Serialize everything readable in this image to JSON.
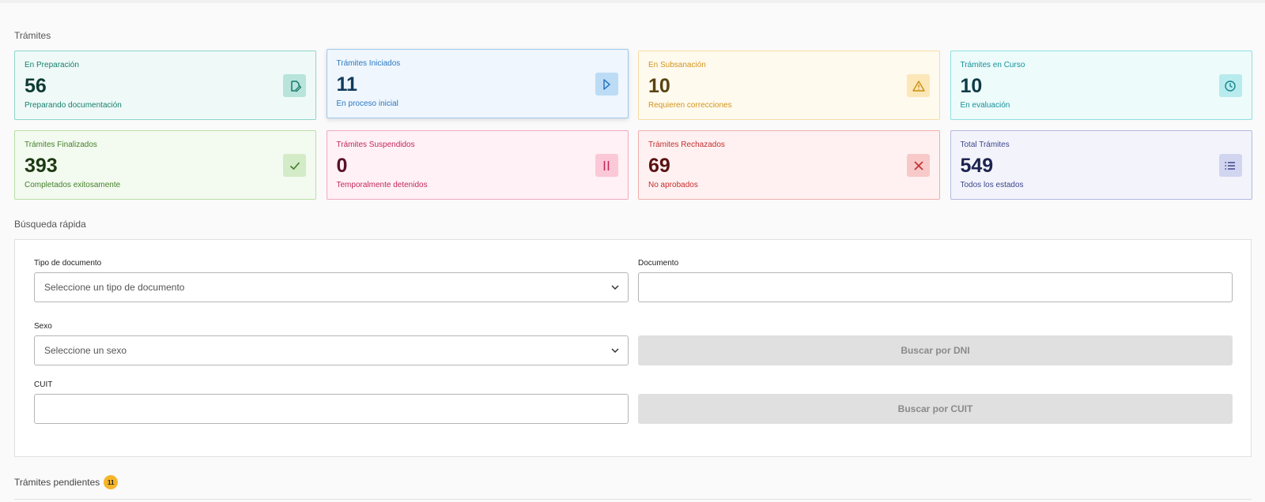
{
  "sections": {
    "tramites": "Trámites",
    "busqueda": "Búsqueda rápida",
    "pendientes": "Trámites pendientes",
    "pendientes_count": "11"
  },
  "cards": [
    {
      "title": "En Preparación",
      "value": "56",
      "sub": "Preparando documentación",
      "icon": "edit-document-icon",
      "colors": {
        "bg": "#effaf8",
        "border": "#8fd5c8",
        "title": "#17806d",
        "value": "#0e3b33",
        "iconbg": "#b9e4dc",
        "icon": "#157a68"
      }
    },
    {
      "title": "Trámites Iniciados",
      "value": "11",
      "sub": "En proceso inicial",
      "icon": "play-icon",
      "colors": {
        "bg": "#eff6fd",
        "border": "#9ec8ec",
        "title": "#2a78c0",
        "value": "#123a5c",
        "iconbg": "#bcdcf6",
        "icon": "#2a78c0"
      }
    },
    {
      "title": "En Subsanación",
      "value": "10",
      "sub": "Requieren correcciones",
      "icon": "warning-icon",
      "colors": {
        "bg": "#fffaee",
        "border": "#f6dca4",
        "title": "#d2951b",
        "value": "#5a4312",
        "iconbg": "#fbe7b8",
        "icon": "#c98f14"
      }
    },
    {
      "title": "Trámites en Curso",
      "value": "10",
      "sub": "En evaluación",
      "icon": "clock-icon",
      "colors": {
        "bg": "#edfbfb",
        "border": "#8fdfe1",
        "title": "#14919a",
        "value": "#0f3b45",
        "iconbg": "#b8ebee",
        "icon": "#13858d"
      }
    },
    {
      "title": "Trámites Finalizados",
      "value": "393",
      "sub": "Completados exitosamente",
      "icon": "check-icon",
      "colors": {
        "bg": "#f3faef",
        "border": "#b9dfa7",
        "title": "#44822b",
        "value": "#1c3a12",
        "iconbg": "#d3ebc6",
        "icon": "#3e7c26"
      }
    },
    {
      "title": "Trámites Suspendidos",
      "value": "0",
      "sub": "Temporalmente detenidos",
      "icon": "pause-icon",
      "colors": {
        "bg": "#fff1f5",
        "border": "#f3a9c1",
        "title": "#c2285e",
        "value": "#5a0f2a",
        "iconbg": "#fbc8d8",
        "icon": "#c2285e"
      }
    },
    {
      "title": "Trámites Rechazados",
      "value": "69",
      "sub": "No aprobados",
      "icon": "close-icon",
      "colors": {
        "bg": "#fff1f1",
        "border": "#f2adad",
        "title": "#c22f2f",
        "value": "#5a1212",
        "iconbg": "#f8c9c9",
        "icon": "#c22f2f"
      }
    },
    {
      "title": "Total Trámites",
      "value": "549",
      "sub": "Todos los estados",
      "icon": "list-icon",
      "colors": {
        "bg": "#f3f4fb",
        "border": "#b3b8e0",
        "title": "#3d468c",
        "value": "#1d2350",
        "iconbg": "#d2d5ef",
        "icon": "#3d468c"
      }
    }
  ],
  "form": {
    "tipo_label": "Tipo de documento",
    "tipo_placeholder": "Seleccione un tipo de documento",
    "documento_label": "Documento",
    "documento_value": "",
    "sexo_label": "Sexo",
    "sexo_placeholder": "Seleccione un sexo",
    "cuit_label": "CUIT",
    "cuit_value": "",
    "buscar_dni": "Buscar por DNI",
    "buscar_cuit": "Buscar por CUIT"
  }
}
